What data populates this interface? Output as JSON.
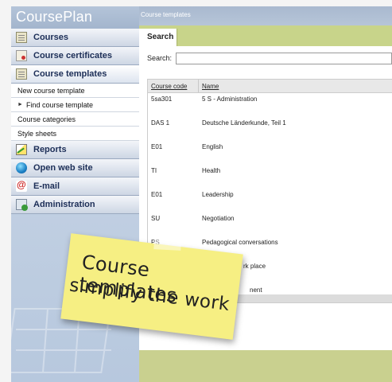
{
  "app": {
    "title": "CoursePlan"
  },
  "sidebar": {
    "items": [
      {
        "label": "Courses",
        "icon": "courses-icon"
      },
      {
        "label": "Course certificates",
        "icon": "certificate-icon"
      },
      {
        "label": "Course templates",
        "icon": "templates-icon"
      },
      {
        "label": "Reports",
        "icon": "reports-icon"
      },
      {
        "label": "Open web site",
        "icon": "globe-icon"
      },
      {
        "label": "E-mail",
        "icon": "email-icon"
      },
      {
        "label": "Administration",
        "icon": "administration-icon"
      }
    ],
    "submenu": [
      {
        "label": "New course template"
      },
      {
        "label": "Find course template"
      },
      {
        "label": "Course categories"
      },
      {
        "label": "Style sheets"
      }
    ]
  },
  "breadcrumb": "Course templates",
  "tabs": [
    {
      "label": "Search"
    }
  ],
  "search": {
    "label": "Search:",
    "value": ""
  },
  "table": {
    "columns": [
      "Course code",
      "Name"
    ],
    "rows": [
      {
        "code": "5sa301",
        "name": "5 S - Administration"
      },
      {
        "code": "DAS 1",
        "name": "Deutsche Länderkunde, Teil 1"
      },
      {
        "code": "E01",
        "name": "English"
      },
      {
        "code": "TI",
        "name": "Health"
      },
      {
        "code": "E01",
        "name": "Leadership"
      },
      {
        "code": "SU",
        "name": "Negotiation"
      },
      {
        "code": "PS",
        "name": "Pedagogical conversations"
      },
      {
        "code": "",
        "name": "rk place"
      },
      {
        "code": "",
        "name": "nent"
      }
    ]
  },
  "note": {
    "line1": "Course templates",
    "line2": "simplify the work"
  },
  "colors": {
    "sidebar": "#b7c8de",
    "tabbar": "#c8d48a",
    "note": "#f6ef83",
    "menu_text": "#1c2e57"
  }
}
